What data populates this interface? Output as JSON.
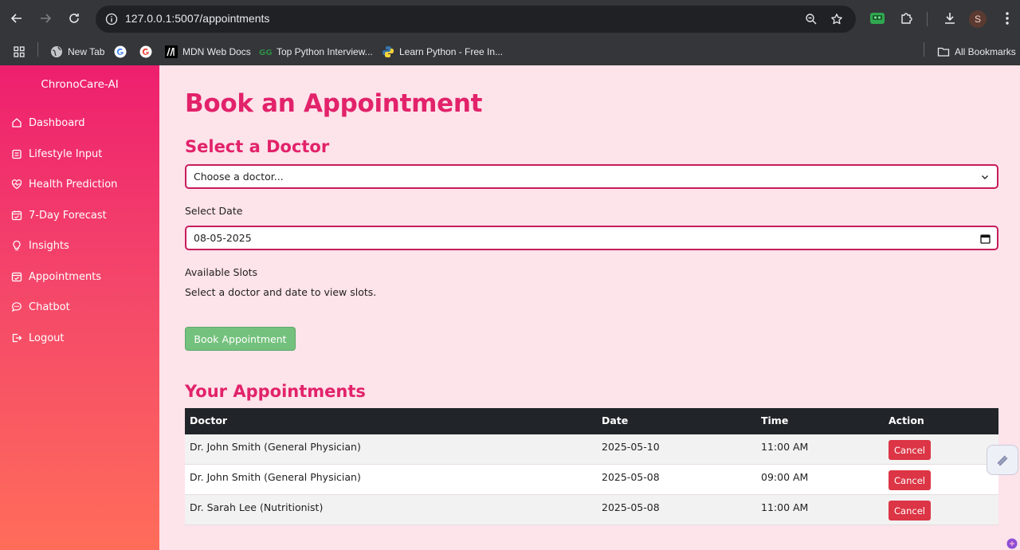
{
  "browser": {
    "url": "127.0.0.1:5007/appointments",
    "profile_initial": "S",
    "icons": {
      "back": "back-arrow-icon",
      "forward": "forward-arrow-icon",
      "reload": "reload-icon",
      "site_info": "info-icon",
      "zoom": "zoom-icon",
      "bookmark": "star-icon",
      "extension_green": "robot-extension-icon",
      "extensions": "puzzle-icon",
      "downloads": "download-icon",
      "menu": "kebab-menu-icon"
    }
  },
  "bookmarks": {
    "items": [
      {
        "label": "New Tab",
        "icon": "globe-icon"
      },
      {
        "label": "",
        "icon": "google-icon"
      },
      {
        "label": "",
        "icon": "google-icon"
      },
      {
        "label": "MDN Web Docs",
        "icon": "mdn-icon"
      },
      {
        "label": "Top Python Interview...",
        "icon": "geeksforgeeks-icon"
      },
      {
        "label": "Learn Python - Free In...",
        "icon": "python-icon"
      }
    ],
    "all_bookmarks": "All Bookmarks"
  },
  "sidebar": {
    "brand": "ChronoCare-AI",
    "items": [
      {
        "label": "Dashboard",
        "icon": "home-icon"
      },
      {
        "label": "Lifestyle Input",
        "icon": "clipboard-icon"
      },
      {
        "label": "Health Prediction",
        "icon": "heart-pulse-icon"
      },
      {
        "label": "7-Day Forecast",
        "icon": "calendar-icon"
      },
      {
        "label": "Insights",
        "icon": "lightbulb-icon"
      },
      {
        "label": "Appointments",
        "icon": "calendar-check-icon"
      },
      {
        "label": "Chatbot",
        "icon": "chat-icon"
      },
      {
        "label": "Logout",
        "icon": "logout-icon"
      }
    ]
  },
  "main": {
    "title": "Book an Appointment",
    "doctor_heading": "Select a Doctor",
    "doctor_select_value": "Choose a doctor...",
    "date_label": "Select Date",
    "date_value": "08-05-2025",
    "slots_label": "Available Slots",
    "slots_message": "Select a doctor and date to view slots.",
    "book_button": "Book Appointment",
    "appointments_heading": "Your Appointments",
    "table": {
      "columns": [
        "Doctor",
        "Date",
        "Time",
        "Action"
      ],
      "rows": [
        {
          "doctor": "Dr. John Smith (General Physician)",
          "date": "2025-05-10",
          "time": "11:00 AM",
          "action": "Cancel"
        },
        {
          "doctor": "Dr. John Smith (General Physician)",
          "date": "2025-05-08",
          "time": "09:00 AM",
          "action": "Cancel"
        },
        {
          "doctor": "Dr. Sarah Lee (Nutritionist)",
          "date": "2025-05-08",
          "time": "11:00 AM",
          "action": "Cancel"
        }
      ]
    }
  },
  "colors": {
    "accent": "#e2226a",
    "sidebar_top": "#ee1f6e",
    "sidebar_bottom": "#ff6d5a",
    "book_button": "#74c17d",
    "cancel_button": "#dc3545",
    "table_header": "#212529"
  }
}
